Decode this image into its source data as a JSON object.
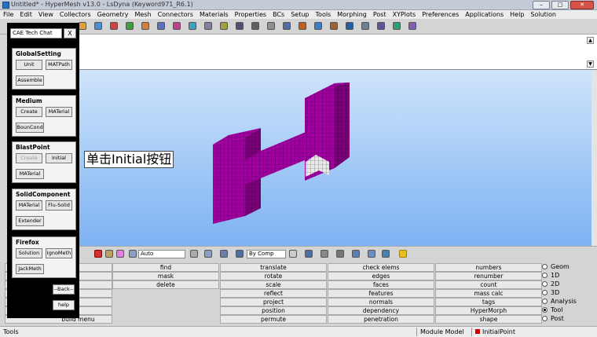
{
  "window": {
    "title": "Untitled* - HyperMesh v13.0 - LsDyna (Keyword971_R6.1)"
  },
  "menu": [
    "File",
    "Edit",
    "View",
    "Collectors",
    "Geometry",
    "Mesh",
    "Connectors",
    "Materials",
    "Properties",
    "BCs",
    "Setup",
    "Tools",
    "Morphing",
    "Post",
    "XYPlots",
    "Preferences",
    "Applications",
    "Help",
    "Solution"
  ],
  "toolbar2": {
    "auto_label": "Auto",
    "by_comp_label": "By Comp"
  },
  "annotation": "单击Initial按钮",
  "panel_cols": [
    [
      "find",
      "mask",
      "delete"
    ],
    [
      "translate",
      "rotate",
      "scale",
      "reflect",
      "project",
      "position",
      "permute"
    ],
    [
      "check elems",
      "edges",
      "faces",
      "features",
      "normals",
      "dependency",
      "penetration"
    ],
    [
      "numbers",
      "renumber",
      "count",
      "mass calc",
      "tags",
      "HyperMorph",
      "shape"
    ]
  ],
  "left_col": [
    "build menu"
  ],
  "radios": [
    {
      "label": "Geom",
      "checked": false
    },
    {
      "label": "1D",
      "checked": false
    },
    {
      "label": "2D",
      "checked": false
    },
    {
      "label": "3D",
      "checked": false
    },
    {
      "label": "Analysis",
      "checked": false
    },
    {
      "label": "Tool",
      "checked": true
    },
    {
      "label": "Post",
      "checked": false
    }
  ],
  "status": {
    "left": "Tools",
    "model": "Module Model",
    "comp": "InitialPoint",
    "comp_color": "#cc0000"
  },
  "chat": {
    "title": "CAE Tech Chat",
    "close": "X",
    "groups": [
      {
        "title": "GlobalSetting",
        "buttons": [
          {
            "label": "Unit"
          },
          {
            "label": "MATPath"
          },
          {
            "label": "Assemble"
          }
        ]
      },
      {
        "title": "Medium",
        "buttons": [
          {
            "label": "Create"
          },
          {
            "label": "MATerial"
          },
          {
            "label": "BounCond"
          }
        ]
      },
      {
        "title": "BlastPoint",
        "buttons": [
          {
            "label": "Create",
            "disabled": true
          },
          {
            "label": "Initial"
          },
          {
            "label": "MATerial"
          }
        ]
      },
      {
        "title": "SolidComponent",
        "buttons": [
          {
            "label": "MATerial"
          },
          {
            "label": "Flu-Solid"
          },
          {
            "label": "Extender"
          }
        ]
      },
      {
        "title": "Firefox",
        "buttons": [
          {
            "label": "Solution"
          },
          {
            "label": "IgnoMeth"
          },
          {
            "label": "JackMeth"
          }
        ]
      }
    ],
    "back": "--Back--",
    "help": "help"
  },
  "colors": {
    "mesh": "#a000a0",
    "viewport_top": "#cfe4fb",
    "viewport_bottom": "#7db2f2"
  }
}
